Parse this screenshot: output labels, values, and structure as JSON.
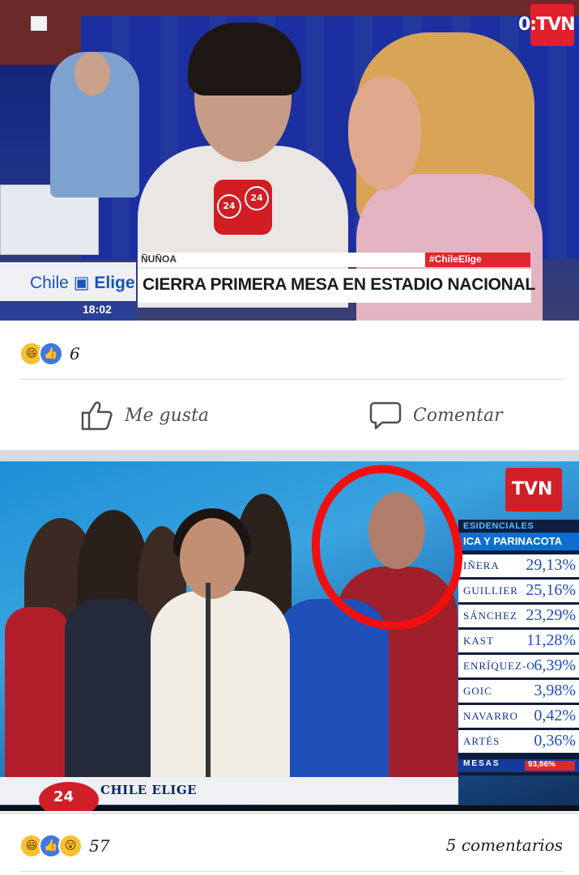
{
  "post1": {
    "broadcast": {
      "channel_logo": "TVN",
      "brand_left": "Chile",
      "brand_right": "Elige",
      "time": "18:02",
      "location": "ÑUÑOA",
      "hashtag": "#ChileElige",
      "headline": "CIERRA PRIMERA MESA EN ESTADIO NACIONAL",
      "mic_badge": "24"
    },
    "reactions": {
      "icons": [
        "haha-emoji-icon",
        "like-emoji-icon"
      ],
      "count": "6"
    },
    "actions": {
      "like_label": "Me gusta",
      "comment_label": "Comentar"
    }
  },
  "post2": {
    "broadcast": {
      "channel_logo": "TVN",
      "results_header_1": "ESIDENCIALES",
      "results_header_2": "ICA Y PARINACOTA",
      "candidates": [
        {
          "name": "IÑERA",
          "pct": "29,13%"
        },
        {
          "name": "GUILLIER",
          "pct": "25,16%"
        },
        {
          "name": "SÁNCHEZ",
          "pct": "23,29%"
        },
        {
          "name": "KAST",
          "pct": "11,28%"
        },
        {
          "name": "ENRÍQUEZ-O",
          "pct": "6,39%"
        },
        {
          "name": "GOIC",
          "pct": "3,98%"
        },
        {
          "name": "NAVARRO",
          "pct": "0,42%"
        },
        {
          "name": "ARTÉS",
          "pct": "0,36%"
        }
      ],
      "mesas_label": "MESAS",
      "mesas_pct": "93,86%",
      "lower_logo": "24",
      "lower_text": "CHILE ELIGE"
    },
    "reactions": {
      "icons": [
        "haha-emoji-icon",
        "like-emoji-icon",
        "wow-emoji-icon"
      ],
      "count": "57"
    },
    "comments_label": "5 comentarios"
  },
  "colors": {
    "facebook_like_blue": "#3f78e6",
    "highlight_red": "#f20f0f",
    "tvn_red": "#d11f28"
  }
}
